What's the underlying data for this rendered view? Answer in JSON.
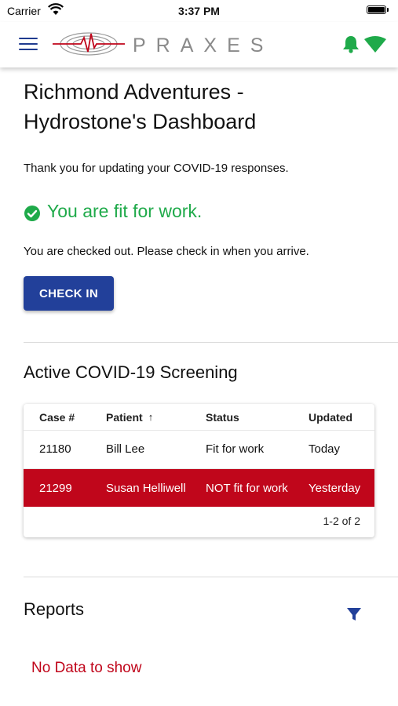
{
  "status_bar": {
    "carrier": "Carrier",
    "time": "3:37 PM"
  },
  "header": {
    "logo_text": "PRAXES",
    "brand_color": "#1f3b8f",
    "alert_color": "#1faa4a"
  },
  "dashboard": {
    "title": "Richmond Adventures - Hydrostone's Dashboard",
    "thanks_message": "Thank you for updating your COVID-19 responses.",
    "fit_message": "You are fit for work.",
    "checked_out_message": "You are checked out. Please check in when you arrive.",
    "check_in_label": "CHECK IN"
  },
  "screening": {
    "title": "Active COVID-19 Screening",
    "columns": [
      "Case #",
      "Patient",
      "Status",
      "Updated"
    ],
    "sort_indicator": "↑",
    "rows": [
      {
        "case": "21180",
        "patient": "Bill Lee",
        "status": "Fit for work",
        "updated": "Today"
      },
      {
        "case": "21299",
        "patient": "Susan Helliwell",
        "status": "NOT fit for work",
        "updated": "Yesterday"
      }
    ],
    "pagination": "1-2 of 2",
    "alert_row_color": "#c0061b"
  },
  "reports": {
    "title": "Reports",
    "empty_message": "No Data to show"
  }
}
